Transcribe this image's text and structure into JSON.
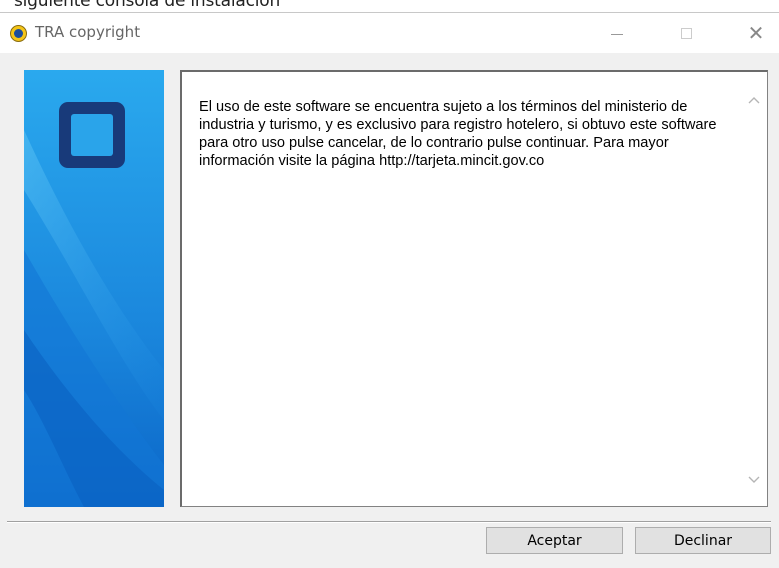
{
  "background": {
    "caption": "siguiente consola de instalación"
  },
  "window": {
    "title": "TRA copyright",
    "controls": {
      "minimize_icon": "minimize-icon",
      "maximize_icon": "maximize-icon",
      "close_icon": "close-icon",
      "close_glyph": "✕"
    }
  },
  "sidebar": {
    "logo_icon": "square-logo-icon",
    "colors": {
      "gradient_top": "#2aa4ea",
      "gradient_bottom": "#0b66c8",
      "logo": "#183a7a"
    }
  },
  "license": {
    "text": "El uso de este software se encuentra sujeto a los términos del ministerio de industria y turismo, y es exclusivo para registro hotelero, si obtuvo este software para otro uso pulse cancelar, de lo contrario pulse continuar. Para mayor información visite la página http://tarjeta.mincit.gov.co"
  },
  "buttons": {
    "accept_label": "Aceptar",
    "decline_label": "Declinar"
  }
}
